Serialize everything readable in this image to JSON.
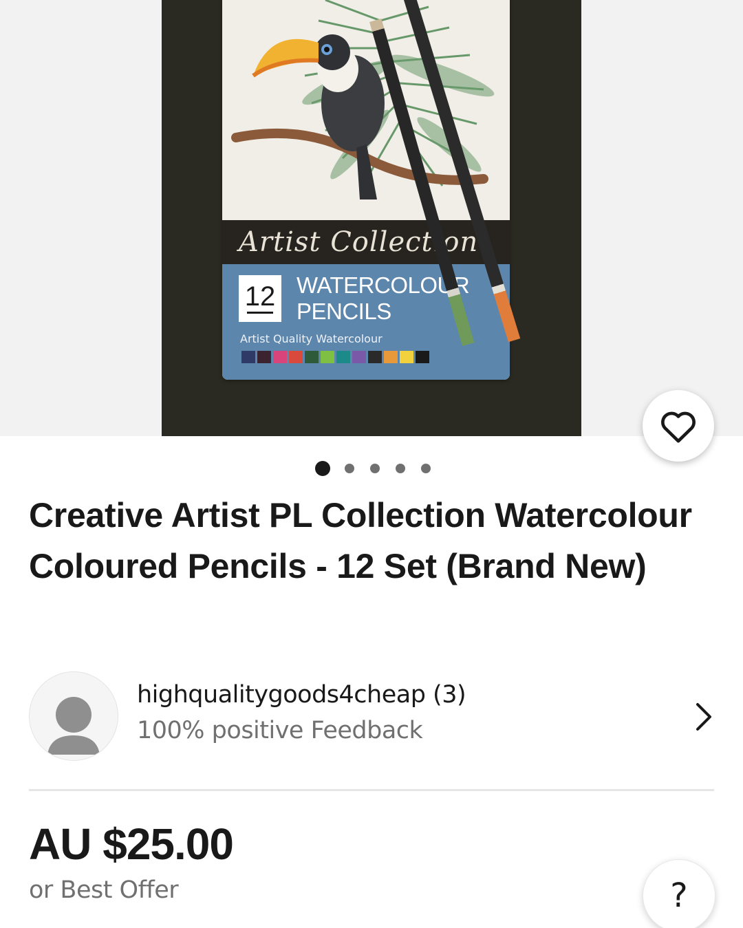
{
  "listing": {
    "title": "Creative Artist PL Collection Watercolour Coloured Pencils - 12 Set (Brand New)",
    "price": "AU $25.00",
    "price_note": "or Best Offer"
  },
  "image_carousel": {
    "total_images": 5,
    "active_index": 0
  },
  "product_image": {
    "brand_script": "Artist Collection",
    "count": "12",
    "product_line_1": "WATERCOLOUR",
    "product_line_2": "PENCILS",
    "tagline": "Artist Quality Watercolour",
    "swatch_colors": [
      "#2f3a66",
      "#3b2430",
      "#d9457a",
      "#d94a3c",
      "#2f5a3a",
      "#7fc043",
      "#1d8a8a",
      "#7a5aa8",
      "#2a2a2a",
      "#e89a3a",
      "#f2d23c",
      "#1a1a1a"
    ]
  },
  "seller": {
    "name": "highqualitygoods4cheap (3)",
    "feedback": "100% positive Feedback"
  },
  "icons": {
    "favorite": "heart-outline-icon",
    "seller_link": "chevron-right-icon",
    "help": "question-mark-icon",
    "avatar": "user-silhouette-icon"
  },
  "help": {
    "label": "?"
  }
}
